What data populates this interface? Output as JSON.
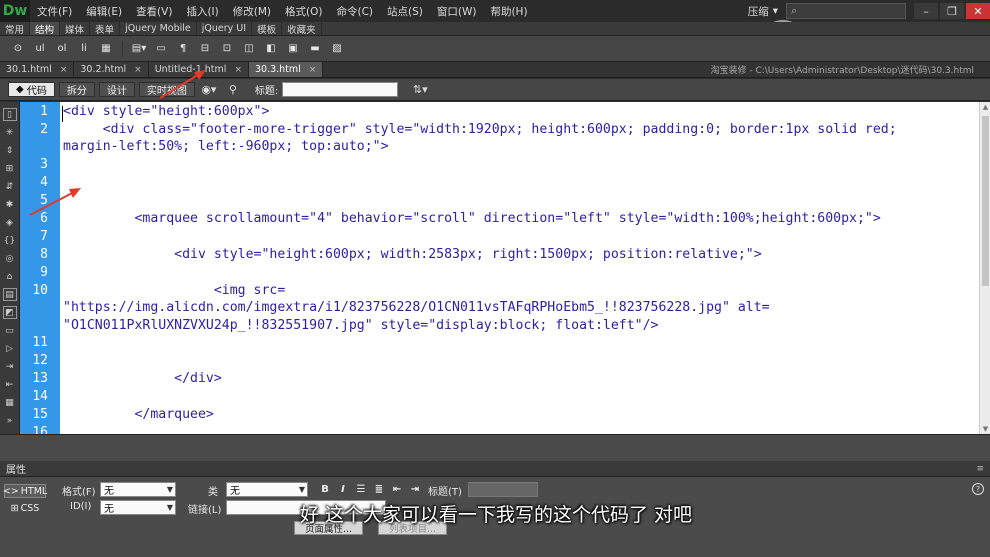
{
  "app": {
    "logo": "Dw",
    "menu": [
      "文件(F)",
      "编辑(E)",
      "查看(V)",
      "插入(I)",
      "修改(M)",
      "格式(O)",
      "命令(C)",
      "站点(S)",
      "窗口(W)",
      "帮助(H)"
    ],
    "workspace_label": "压缩",
    "watermark": "虎课网"
  },
  "insert_panel": {
    "tabs": [
      "常用",
      "结构",
      "媒体",
      "表单",
      "jQuery Mobile",
      "jQuery UI",
      "模板",
      "收藏夹"
    ],
    "active_tab": "结构",
    "buttons": [
      "ul",
      "ol",
      "li"
    ]
  },
  "document_tabs": {
    "tabs": [
      {
        "label": "30.1.html",
        "close": "×"
      },
      {
        "label": "30.2.html",
        "close": "×"
      },
      {
        "label": "Untitled-1.html",
        "close": "×"
      },
      {
        "label": "30.3.html",
        "close": "×"
      }
    ],
    "active_index": 3,
    "path": "淘宝装修 - C:\\Users\\Administrator\\Desktop\\迷代码\\30.3.html"
  },
  "doc_toolbar": {
    "views": [
      "代码",
      "拆分",
      "设计",
      "实时视图"
    ],
    "active_view": "代码",
    "title_label": "标题:",
    "title_value": ""
  },
  "code": {
    "line_numbers": [
      "1",
      "2",
      "3",
      "4",
      "5",
      "6",
      "7",
      "8",
      "9",
      "10",
      "11",
      "12",
      "13",
      "14",
      "15",
      "16"
    ],
    "lines": [
      "<div style=\"height:600px\">",
      "     <div class=\"footer-more-trigger\" style=\"width:1920px; height:600px; padding:0; border:1px solid red;",
      "margin-left:50%; left:-960px; top:auto;\">",
      "",
      "",
      "",
      "         <marquee scrollamount=\"4\" behavior=\"scroll\" direction=\"left\" style=\"width:100%;height:600px;\">",
      "",
      "              <div style=\"height:600px; width:2583px; right:1500px; position:relative;\">",
      "",
      "                   <img src=",
      "\"https://img.alicdn.com/imgextra/i1/823756228/O1CN011vsTAFqRPHoEbm5_!!823756228.jpg\" alt=",
      "\"O1CN011PxRlUXNZVXU24p_!!832551907.jpg\" style=\"display:block; float:left\"/>",
      "",
      "",
      "              </div>",
      "",
      "         </marquee>",
      ""
    ]
  },
  "properties": {
    "title": "属性",
    "html_mode": "HTML",
    "css_mode": "CSS",
    "format_label": "格式(F)",
    "format_value": "无",
    "class_label": "类",
    "class_value": "无",
    "id_label": "ID(I)",
    "id_value": "无",
    "link_label": "链接(L)",
    "bold": "B",
    "italic": "I",
    "title_label": "标题(T)",
    "page_props": "页面属性...",
    "list_item": "列表项目..."
  },
  "subtitle": "好  这个大家可以看一下我写的这个代码了  对吧"
}
